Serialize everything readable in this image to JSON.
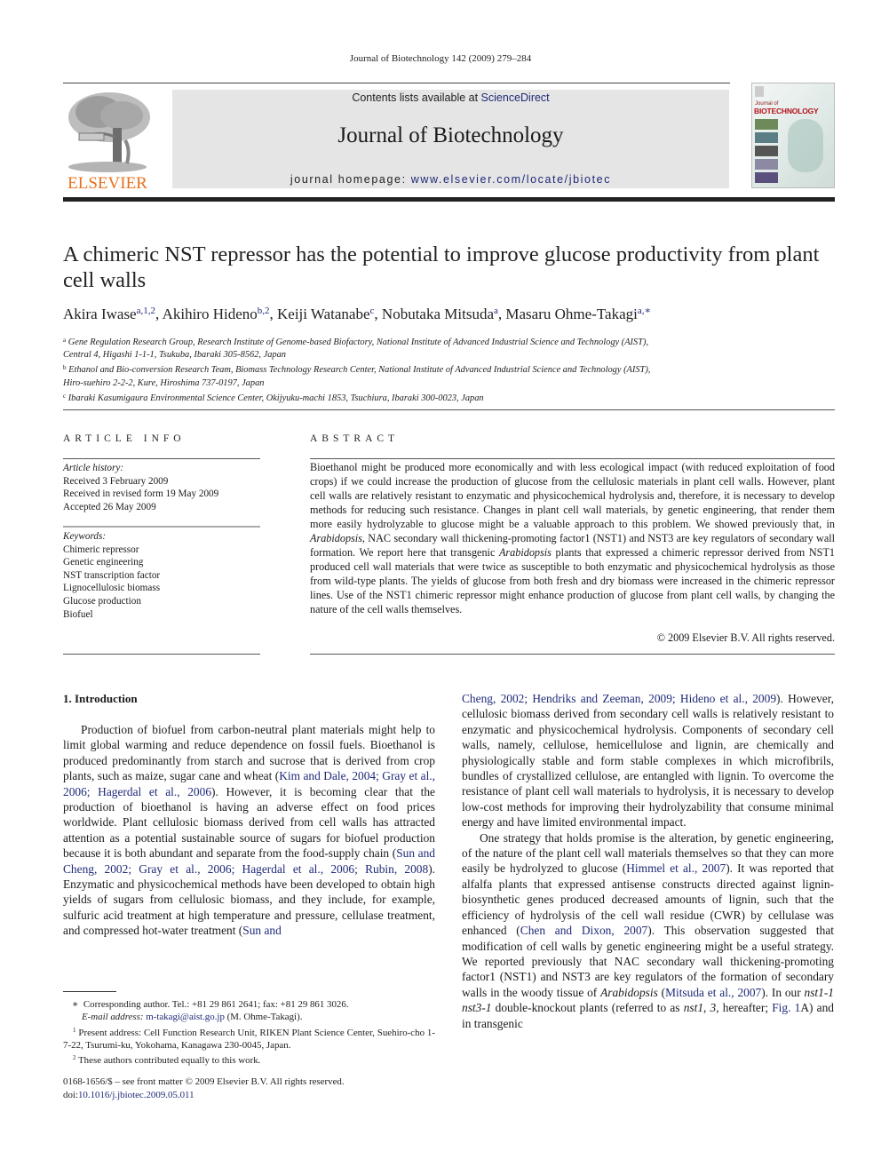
{
  "running_head": "Journal of Biotechnology 142 (2009) 279–284",
  "masthead": {
    "publisher_logo_text": "ELSEVIER",
    "contents_prefix": "Contents lists available at ",
    "contents_link": "ScienceDirect",
    "journal_title": "Journal of Biotechnology",
    "homepage_prefix": "journal homepage: ",
    "homepage_link": "www.elsevier.com/locate/jbiotec",
    "cover_small": "Journal of",
    "cover_title": "BIOTECHNOLOGY"
  },
  "colors": {
    "link": "#1f2a78",
    "elsevier_orange": "#e9711c",
    "masthead_bg": "#e5e5e5",
    "cover_title": "#b5121b"
  },
  "article": {
    "title": "A chimeric NST repressor has the potential to improve glucose productivity from plant cell walls",
    "authors": [
      {
        "name": "Akira Iwase",
        "sup": "a,1,2"
      },
      {
        "name": "Akihiro Hideno",
        "sup": "b,2"
      },
      {
        "name": "Keiji Watanabe",
        "sup": "c"
      },
      {
        "name": "Nobutaka Mitsuda",
        "sup": "a"
      },
      {
        "name": "Masaru Ohme-Takagi",
        "sup": "a,∗"
      }
    ],
    "affiliations": [
      {
        "mark": "a",
        "line1": "Gene Regulation Research Group, Research Institute of Genome-based Biofactory, National Institute of Advanced Industrial Science and Technology (AIST),",
        "line2": "Central 4, Higashi 1-1-1, Tsukuba, Ibaraki 305-8562, Japan"
      },
      {
        "mark": "b",
        "line1": "Ethanol and Bio-conversion Research Team, Biomass Technology Research Center, National Institute of Advanced Industrial Science and Technology (AIST),",
        "line2": "Hiro-suehiro 2-2-2, Kure, Hiroshima 737-0197, Japan"
      },
      {
        "mark": "c",
        "line1": "Ibaraki Kasumigaura Environmental Science Center, Okijyuku-machi 1853, Tsuchiura, Ibaraki 300-0023, Japan",
        "line2": ""
      }
    ]
  },
  "article_info": {
    "heading": "ARTICLE INFO",
    "history_label": "Article history:",
    "history": [
      "Received 3 February 2009",
      "Received in revised form 19 May 2009",
      "Accepted 26 May 2009"
    ],
    "keywords_label": "Keywords:",
    "keywords": [
      "Chimeric repressor",
      "Genetic engineering",
      "NST transcription factor",
      "Lignocellulosic biomass",
      "Glucose production",
      "Biofuel"
    ]
  },
  "abstract": {
    "heading": "ABSTRACT",
    "p1": "Bioethanol might be produced more economically and with less ecological impact (with reduced exploitation of food crops) if we could increase the production of glucose from the cellulosic materials in plant cell walls. However, plant cell walls are relatively resistant to enzymatic and physicochemical hydrolysis and, therefore, it is necessary to develop methods for reducing such resistance. Changes in plant cell wall materials, by genetic engineering, that render them more easily hydrolyzable to glucose might be a valuable approach to this problem. We showed previously that, in ",
    "it1": "Arabidopsis",
    "p2": ", NAC secondary wall thickening-promoting factor1 (NST1) and NST3 are key regulators of secondary wall formation. We report here that transgenic ",
    "it2": "Arabidopsis",
    "p3": " plants that expressed a chimeric repressor derived from NST1 produced cell wall materials that were twice as susceptible to both enzymatic and physicochemical hydrolysis as those from wild-type plants. The yields of glucose from both fresh and dry biomass were increased in the chimeric repressor lines. Use of the NST1 chimeric repressor might enhance production of glucose from plant cell walls, by changing the nature of the cell walls themselves.",
    "copyright": "© 2009 Elsevier B.V. All rights reserved."
  },
  "intro": {
    "heading": "1.  Introduction",
    "left": {
      "t1": "Production of biofuel from carbon-neutral plant materials might help to limit global warming and reduce dependence on fossil fuels. Bioethanol is produced predominantly from starch and sucrose that is derived from crop plants, such as maize, sugar cane and wheat (",
      "c1": "Kim and Dale, 2004; Gray et al., 2006; Hagerdal et al., 2006",
      "t2": "). However, it is becoming clear that the production of bioethanol is having an adverse effect on food prices worldwide. Plant cellulosic biomass derived from cell walls has attracted attention as a potential sustainable source of sugars for biofuel production because it is both abundant and separate from the food-supply chain (",
      "c2": "Sun and Cheng, 2002; Gray et al., 2006; Hagerdal et al., 2006; Rubin, 2008",
      "t3": "). Enzymatic and physicochemical methods have been developed to obtain high yields of sugars from cellulosic biomass, and they include, for example, sulfuric acid treatment at high temperature and pressure, cellulase treatment, and compressed hot-water treatment (",
      "c3": "Sun and"
    },
    "right": {
      "c0": "Cheng, 2002; Hendriks and Zeeman, 2009; Hideno et al., 2009",
      "t0": "). However, cellulosic biomass derived from secondary cell walls is relatively resistant to enzymatic and physicochemical hydrolysis. Components of secondary cell walls, namely, cellulose, hemicellulose and lignin, are chemically and physiologically stable and form stable complexes in which microfibrils, bundles of crystallized cellulose, are entangled with lignin. To overcome the resistance of plant cell wall materials to hydrolysis, it is necessary to develop low-cost methods for improving their hydrolyzability that consume minimal energy and have limited environmental impact.",
      "p2a": "One strategy that holds promise is the alteration, by genetic engineering, of the nature of the plant cell wall materials themselves so that they can more easily be hydrolyzed to glucose (",
      "c1": "Himmel et al., 2007",
      "p2b": "). It was reported that alfalfa plants that expressed antisense constructs directed against lignin-biosynthetic genes produced decreased amounts of lignin, such that the efficiency of hydrolysis of the cell wall residue (CWR) by cellulase was enhanced (",
      "c2": "Chen and Dixon, 2007",
      "p2c": "). This observation suggested that modification of cell walls by genetic engineering might be a useful strategy. We reported previously that NAC secondary wall thickening-promoting factor1 (NST1) and NST3 are key regulators of the formation of secondary walls in the woody tissue of ",
      "it1": "Arabidopsis",
      "p2d": " (",
      "c3": "Mitsuda et al., 2007",
      "p2e": "). In our ",
      "it2": "nst1-1 nst3-1",
      "p2f": " double-knockout plants (referred to as ",
      "it3": "nst1, 3",
      "p2g": ", hereafter; ",
      "c4": "Fig. 1",
      "p2h": "A) and in transgenic"
    }
  },
  "footnotes": {
    "corresponding": "Corresponding author. Tel.: +81 29 861 2641; fax: +81 29 861 3026.",
    "email_label": "E-mail address:",
    "email": "m-takagi@aist.go.jp",
    "email_suffix": " (M. Ohme-Takagi).",
    "fn1": "Present address: Cell Function Research Unit, RIKEN Plant Science Center, Suehiro-cho 1-7-22, Tsurumi-ku, Yokohama, Kanagawa 230-0045, Japan.",
    "fn2": "These authors contributed equally to this work.",
    "issn": "0168-1656/$ – see front matter © 2009 Elsevier B.V. All rights reserved.",
    "doi_label": "doi:",
    "doi": "10.1016/j.jbiotec.2009.05.011"
  }
}
